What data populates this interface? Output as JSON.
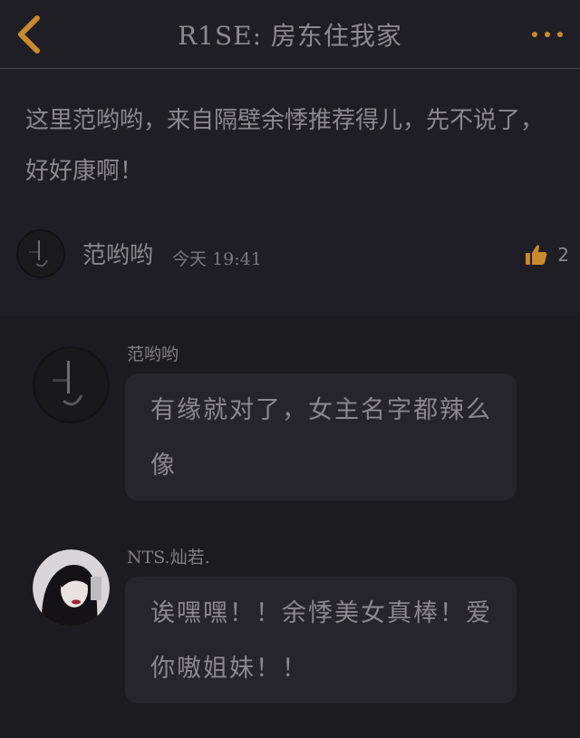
{
  "header": {
    "title": "R1SE: 房东住我家"
  },
  "post": {
    "text": "这里范哟哟，来自隔壁余悸推荐得儿，先不说了，好好康啊！",
    "author": "范哟哟",
    "time": "今天 19:41",
    "like_count": "2"
  },
  "comments": [
    {
      "author": "范哟哟",
      "text": "有缘就对了，女主名字都辣么像"
    },
    {
      "author": "NTS.灿若.",
      "text": "诶嘿嘿！！余悸美女真棒！爱你嗷姐妹！！"
    }
  ],
  "colors": {
    "accent": "#c98a2e",
    "background": "#1f1e24",
    "comment_bubble": "#26252b"
  },
  "icons": [
    "back-chevron-icon",
    "more-dots-icon",
    "thumbs-up-icon"
  ]
}
